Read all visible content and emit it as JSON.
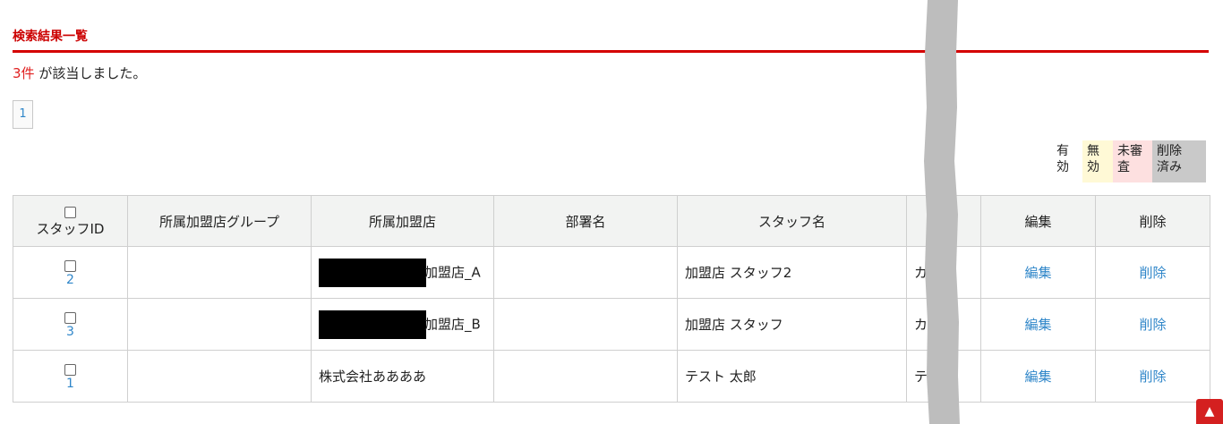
{
  "section": {
    "title": "検索結果一覧"
  },
  "result": {
    "count": "3件",
    "message": " が該当しました。"
  },
  "pagination": {
    "current_page": "1"
  },
  "legend": {
    "items": [
      {
        "label_line1": "有",
        "label_line2": "効",
        "color": "#ffffff"
      },
      {
        "label_line1": "無",
        "label_line2": "効",
        "color": "#fff9d6"
      },
      {
        "label_line1": "未審",
        "label_line2": "査",
        "color": "#fde0e0"
      },
      {
        "label_line1": "削除",
        "label_line2": "済み",
        "color": "#c9c9c9"
      }
    ]
  },
  "table": {
    "headers": {
      "staff_id": "スタッフID",
      "group": "所属加盟店グループ",
      "store": "所属加盟店",
      "department": "部署名",
      "staff_name": "スタッフ名",
      "kana": "",
      "edit": "編集",
      "delete": "削除"
    },
    "rows": [
      {
        "id": "2",
        "group": "",
        "store": "加盟店_A",
        "store_redacted": true,
        "department": "",
        "staff_name": "加盟店 スタッフ2",
        "kana": "カ",
        "edit": "編集",
        "delete": "削除"
      },
      {
        "id": "3",
        "group": "",
        "store": "加盟店_B",
        "store_redacted": true,
        "department": "",
        "staff_name": "加盟店 スタッフ",
        "kana": "カ",
        "edit": "編集",
        "delete": "削除"
      },
      {
        "id": "1",
        "group": "",
        "store": "株式会社ああああ",
        "store_redacted": false,
        "department": "",
        "staff_name": "テスト 太郎",
        "kana": "テ",
        "edit": "編集",
        "delete": "削除"
      }
    ]
  },
  "scroll_top": {
    "icon": "arrow-up-icon"
  },
  "colors": {
    "accent": "#d40000",
    "link": "#2f86c9",
    "overlay": "#bdbdbd"
  }
}
